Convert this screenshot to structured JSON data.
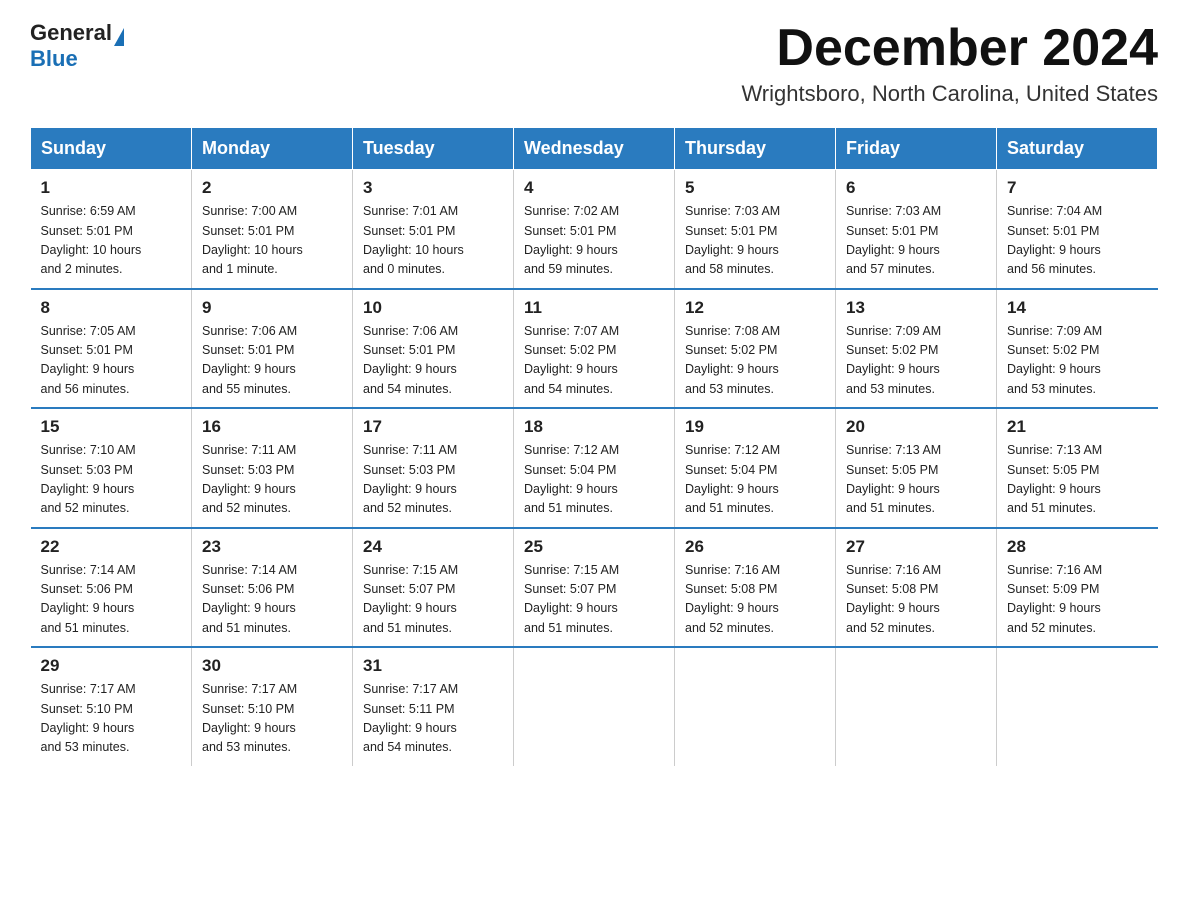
{
  "logo": {
    "general": "General",
    "blue": "Blue"
  },
  "title": "December 2024",
  "location": "Wrightsboro, North Carolina, United States",
  "days_of_week": [
    "Sunday",
    "Monday",
    "Tuesday",
    "Wednesday",
    "Thursday",
    "Friday",
    "Saturday"
  ],
  "weeks": [
    [
      {
        "day": "1",
        "info": "Sunrise: 6:59 AM\nSunset: 5:01 PM\nDaylight: 10 hours\nand 2 minutes."
      },
      {
        "day": "2",
        "info": "Sunrise: 7:00 AM\nSunset: 5:01 PM\nDaylight: 10 hours\nand 1 minute."
      },
      {
        "day": "3",
        "info": "Sunrise: 7:01 AM\nSunset: 5:01 PM\nDaylight: 10 hours\nand 0 minutes."
      },
      {
        "day": "4",
        "info": "Sunrise: 7:02 AM\nSunset: 5:01 PM\nDaylight: 9 hours\nand 59 minutes."
      },
      {
        "day": "5",
        "info": "Sunrise: 7:03 AM\nSunset: 5:01 PM\nDaylight: 9 hours\nand 58 minutes."
      },
      {
        "day": "6",
        "info": "Sunrise: 7:03 AM\nSunset: 5:01 PM\nDaylight: 9 hours\nand 57 minutes."
      },
      {
        "day": "7",
        "info": "Sunrise: 7:04 AM\nSunset: 5:01 PM\nDaylight: 9 hours\nand 56 minutes."
      }
    ],
    [
      {
        "day": "8",
        "info": "Sunrise: 7:05 AM\nSunset: 5:01 PM\nDaylight: 9 hours\nand 56 minutes."
      },
      {
        "day": "9",
        "info": "Sunrise: 7:06 AM\nSunset: 5:01 PM\nDaylight: 9 hours\nand 55 minutes."
      },
      {
        "day": "10",
        "info": "Sunrise: 7:06 AM\nSunset: 5:01 PM\nDaylight: 9 hours\nand 54 minutes."
      },
      {
        "day": "11",
        "info": "Sunrise: 7:07 AM\nSunset: 5:02 PM\nDaylight: 9 hours\nand 54 minutes."
      },
      {
        "day": "12",
        "info": "Sunrise: 7:08 AM\nSunset: 5:02 PM\nDaylight: 9 hours\nand 53 minutes."
      },
      {
        "day": "13",
        "info": "Sunrise: 7:09 AM\nSunset: 5:02 PM\nDaylight: 9 hours\nand 53 minutes."
      },
      {
        "day": "14",
        "info": "Sunrise: 7:09 AM\nSunset: 5:02 PM\nDaylight: 9 hours\nand 53 minutes."
      }
    ],
    [
      {
        "day": "15",
        "info": "Sunrise: 7:10 AM\nSunset: 5:03 PM\nDaylight: 9 hours\nand 52 minutes."
      },
      {
        "day": "16",
        "info": "Sunrise: 7:11 AM\nSunset: 5:03 PM\nDaylight: 9 hours\nand 52 minutes."
      },
      {
        "day": "17",
        "info": "Sunrise: 7:11 AM\nSunset: 5:03 PM\nDaylight: 9 hours\nand 52 minutes."
      },
      {
        "day": "18",
        "info": "Sunrise: 7:12 AM\nSunset: 5:04 PM\nDaylight: 9 hours\nand 51 minutes."
      },
      {
        "day": "19",
        "info": "Sunrise: 7:12 AM\nSunset: 5:04 PM\nDaylight: 9 hours\nand 51 minutes."
      },
      {
        "day": "20",
        "info": "Sunrise: 7:13 AM\nSunset: 5:05 PM\nDaylight: 9 hours\nand 51 minutes."
      },
      {
        "day": "21",
        "info": "Sunrise: 7:13 AM\nSunset: 5:05 PM\nDaylight: 9 hours\nand 51 minutes."
      }
    ],
    [
      {
        "day": "22",
        "info": "Sunrise: 7:14 AM\nSunset: 5:06 PM\nDaylight: 9 hours\nand 51 minutes."
      },
      {
        "day": "23",
        "info": "Sunrise: 7:14 AM\nSunset: 5:06 PM\nDaylight: 9 hours\nand 51 minutes."
      },
      {
        "day": "24",
        "info": "Sunrise: 7:15 AM\nSunset: 5:07 PM\nDaylight: 9 hours\nand 51 minutes."
      },
      {
        "day": "25",
        "info": "Sunrise: 7:15 AM\nSunset: 5:07 PM\nDaylight: 9 hours\nand 51 minutes."
      },
      {
        "day": "26",
        "info": "Sunrise: 7:16 AM\nSunset: 5:08 PM\nDaylight: 9 hours\nand 52 minutes."
      },
      {
        "day": "27",
        "info": "Sunrise: 7:16 AM\nSunset: 5:08 PM\nDaylight: 9 hours\nand 52 minutes."
      },
      {
        "day": "28",
        "info": "Sunrise: 7:16 AM\nSunset: 5:09 PM\nDaylight: 9 hours\nand 52 minutes."
      }
    ],
    [
      {
        "day": "29",
        "info": "Sunrise: 7:17 AM\nSunset: 5:10 PM\nDaylight: 9 hours\nand 53 minutes."
      },
      {
        "day": "30",
        "info": "Sunrise: 7:17 AM\nSunset: 5:10 PM\nDaylight: 9 hours\nand 53 minutes."
      },
      {
        "day": "31",
        "info": "Sunrise: 7:17 AM\nSunset: 5:11 PM\nDaylight: 9 hours\nand 54 minutes."
      },
      {
        "day": "",
        "info": ""
      },
      {
        "day": "",
        "info": ""
      },
      {
        "day": "",
        "info": ""
      },
      {
        "day": "",
        "info": ""
      }
    ]
  ]
}
